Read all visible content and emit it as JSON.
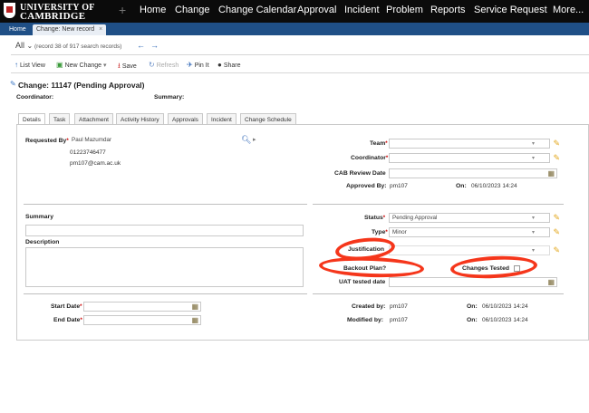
{
  "brand": {
    "line1": "UNIVERSITY OF",
    "line2": "CAMBRIDGE"
  },
  "nav": {
    "plus": "+",
    "items": [
      "Home",
      "Change",
      "Change Calendar",
      "Approval",
      "Incident",
      "Problem",
      "Reports",
      "Service Request",
      "More..."
    ]
  },
  "tabs": {
    "home": "Home",
    "current": "Change: New record",
    "close": "×"
  },
  "recordnav": {
    "all": "All",
    "caret": "⌄",
    "info": "(record 38 of 917 search records)",
    "prev": "←",
    "next": "→"
  },
  "toolbar": {
    "list_view": "List View",
    "new_change": "New Change",
    "save": "Save",
    "refresh": "Refresh",
    "pin": "Pin It",
    "share": "Share"
  },
  "record": {
    "title": "Change: 11147 (Pending Approval)",
    "coordinator_label": "Coordinator:",
    "summary_label": "Summary:"
  },
  "subtabs": [
    "Details",
    "Task",
    "Attachment",
    "Activity History",
    "Approvals",
    "Incident",
    "Change Schedule"
  ],
  "form": {
    "requested_by_label": "Requested By",
    "requested_by_value": "Paul Mazumdar",
    "phone": "01223746477",
    "email": "pm107@cam.ac.uk",
    "team_label": "Team",
    "team_value": "",
    "coordinator_label": "Coordinator",
    "coordinator_value": "",
    "cab_label": "CAB Review Date",
    "cab_value": "",
    "approved_by_label": "Approved By:",
    "approved_by_value": "pm107",
    "approved_on_label": "On:",
    "approved_on_value": "06/10/2023 14:24",
    "summary_label": "Summary",
    "summary_value": "",
    "description_label": "Description",
    "description_value": "",
    "status_label": "Status",
    "status_value": "Pending Approval",
    "type_label": "Type",
    "type_value": "Minor",
    "justification_label": "Justification",
    "justification_value": "",
    "backout_label": "Backout Plan?",
    "changes_tested_label": "Changes Tested",
    "uat_label": "UAT tested date",
    "uat_value": "",
    "start_label": "Start Date",
    "end_label": "End Date",
    "created_by_label": "Created by:",
    "created_by_value": "pm107",
    "created_on_label": "On:",
    "created_on_value": "06/10/2023 14:24",
    "modified_by_label": "Modified by:",
    "modified_by_value": "pm107",
    "modified_on_label": "On:",
    "modified_on_value": "06/10/2023 14:24"
  },
  "colors": {
    "nav_bg": "#0b0b0b",
    "tab_bar": "#1f4f86",
    "annotation": "#f5361b",
    "pencil": "#e2a61b"
  },
  "icons": {
    "search": "search-icon",
    "pencil": "pencil-icon",
    "calendar": "calendar-icon",
    "dropdown": "chevron-down-icon"
  }
}
